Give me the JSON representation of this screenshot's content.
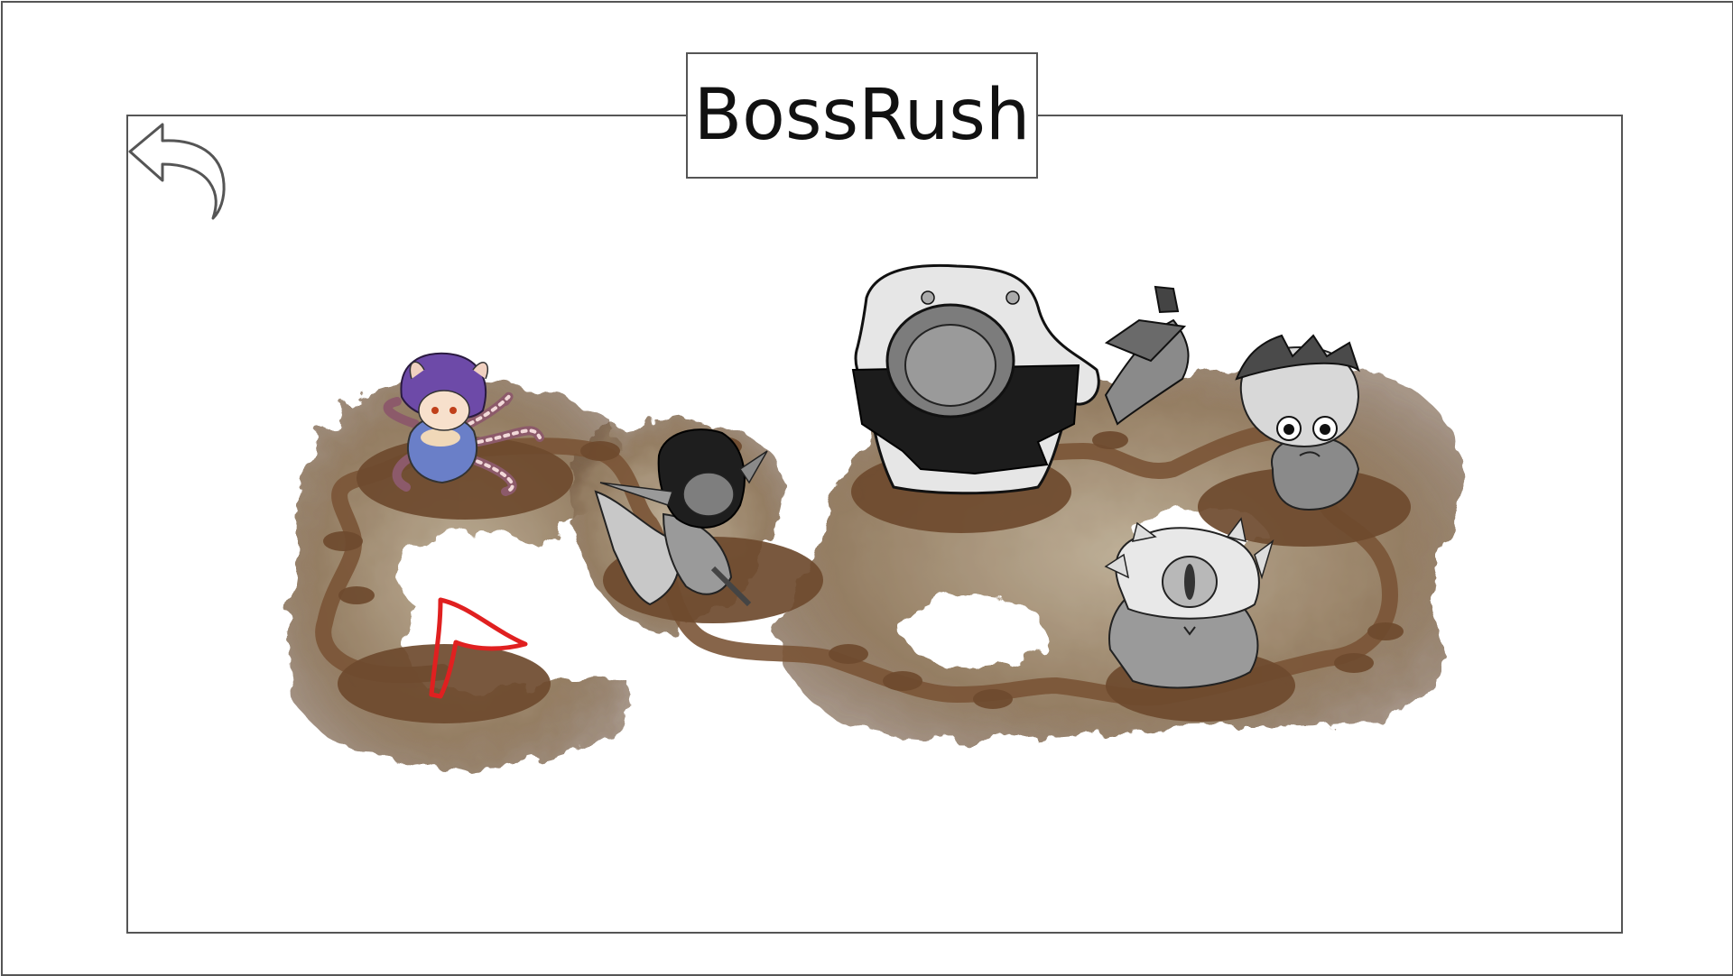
{
  "title": "BossRush",
  "back_button": {
    "icon": "back-arrow-icon"
  },
  "map": {
    "nodes": [
      {
        "id": "start",
        "icon": "red-flag-icon",
        "locked": false
      },
      {
        "id": "boss-1",
        "icon": "spider-girl-boss",
        "locked": false
      },
      {
        "id": "boss-2",
        "icon": "dark-elf-boss",
        "locked": true
      },
      {
        "id": "boss-3",
        "icon": "executioner-boss",
        "locked": true
      },
      {
        "id": "boss-4",
        "icon": "cyclops-beast-boss",
        "locked": true
      },
      {
        "id": "boss-5",
        "icon": "goblin-boss",
        "locked": true
      }
    ]
  },
  "colors": {
    "border": "#555555",
    "dirt": "#7a5a3a",
    "dirt_dark": "#5e4128",
    "flag": "#e02020"
  }
}
